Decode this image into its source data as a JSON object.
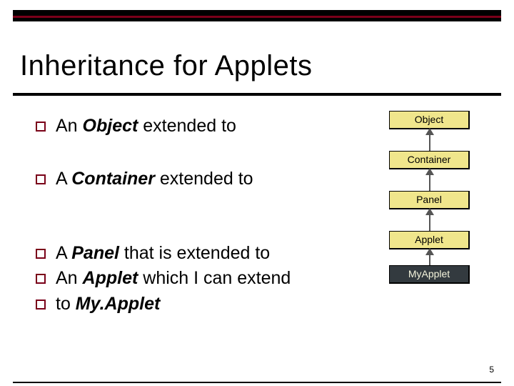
{
  "title": "Inheritance for Applets",
  "bullets": [
    {
      "pre": "An ",
      "strong": "Object",
      "post": " extended to"
    },
    {
      "pre": "A ",
      "strong": "Container",
      "post": " extended to"
    },
    {
      "pre": "A ",
      "strong": "Panel",
      "post": " that is extended to"
    },
    {
      "pre": "An ",
      "strong": "Applet",
      "post": " which I can extend"
    },
    {
      "pre": "to ",
      "strong": "",
      "post": "",
      "italic": "My.Applet"
    }
  ],
  "diagram": {
    "nodes": [
      {
        "label": "Object",
        "style": "yellow"
      },
      {
        "label": "Container",
        "style": "yellow"
      },
      {
        "label": "Panel",
        "style": "yellow"
      },
      {
        "label": "Applet",
        "style": "yellow"
      },
      {
        "label": "MyApplet",
        "style": "dark"
      }
    ]
  },
  "page_number": "5"
}
